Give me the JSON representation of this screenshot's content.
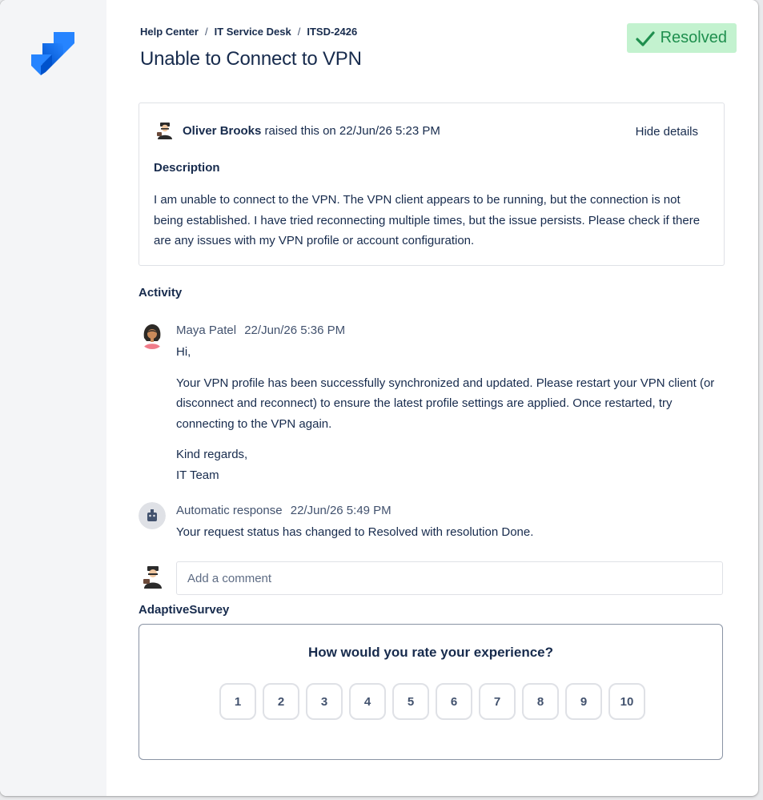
{
  "breadcrumb": {
    "items": [
      "Help Center",
      "IT Service Desk",
      "ITSD-2426"
    ],
    "separator": "/"
  },
  "request": {
    "title": "Unable to Connect to VPN",
    "status": "Resolved",
    "status_color": "#1f8f4e",
    "status_bg": "#c3f2cf"
  },
  "details": {
    "raiser_name": "Oliver Brooks",
    "raised_text": "raised this on 22/Jun/26 5:23 PM",
    "hide_details_label": "Hide details",
    "description_heading": "Description",
    "description": "I am unable to connect to the VPN. The VPN client appears to be running, but the connection is not being established. I have tried reconnecting multiple times, but the issue persists. Please check if there are any issues with my VPN profile or account configuration."
  },
  "activity": {
    "heading": "Activity",
    "items": [
      {
        "author": "Maya Patel",
        "timestamp": "22/Jun/26 5:36 PM",
        "paragraphs": [
          "Hi,",
          "Your VPN profile has been successfully synchronized and updated. Please restart your VPN client (or disconnect and reconnect) to ensure the latest profile settings are applied. Once restarted, try connecting to the VPN again.",
          "Kind regards,",
          "IT Team"
        ]
      },
      {
        "author": "Automatic response",
        "timestamp": "22/Jun/26 5:49 PM",
        "paragraphs": [
          "Your request status has changed to Resolved with resolution Done."
        ]
      }
    ]
  },
  "comment": {
    "placeholder": "Add a comment"
  },
  "survey": {
    "heading": "AdaptiveSurvey",
    "question": "How would you rate your experience?",
    "ratings": [
      "1",
      "2",
      "3",
      "4",
      "5",
      "6",
      "7",
      "8",
      "9",
      "10"
    ]
  },
  "icons": {
    "logo": "jira-service-management-logo",
    "status": "checkmark-icon",
    "bot": "robot-icon"
  },
  "colors": {
    "brand_blue": "#2684ff",
    "text": "#172b4d",
    "muted": "#42526e"
  }
}
